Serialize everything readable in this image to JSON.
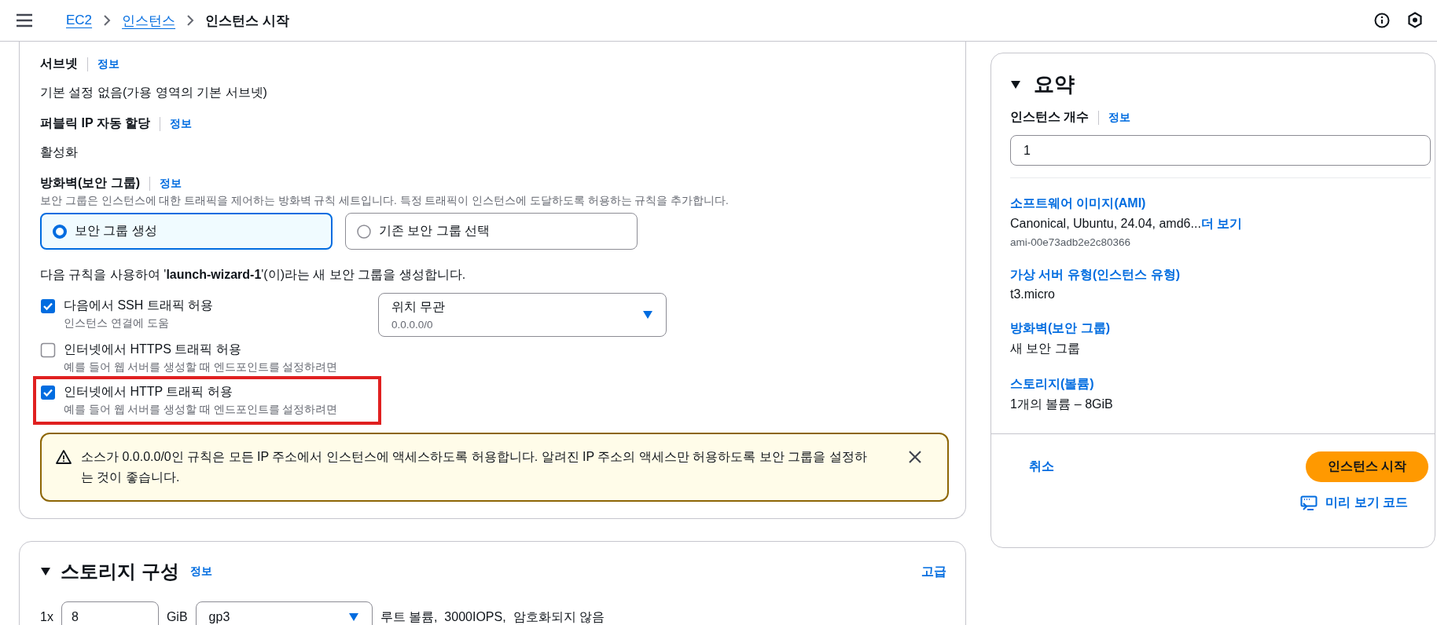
{
  "breadcrumbs": [
    {
      "label": "EC2",
      "link": true
    },
    {
      "label": "인스턴스",
      "link": true
    },
    {
      "label": "인스턴스 시작",
      "link": false
    }
  ],
  "network": {
    "subnet": {
      "label": "서브넷",
      "info": "정보",
      "value": "기본 설정 없음(가용 영역의 기본 서브넷)"
    },
    "public_ip": {
      "label": "퍼블릭 IP 자동 할당",
      "info": "정보",
      "value": "활성화"
    },
    "firewall": {
      "label": "방화벽(보안 그룹)",
      "info": "정보",
      "description": "보안 그룹은 인스턴스에 대한 트래픽을 제어하는 방화벽 규칙 세트입니다. 특정 트래픽이 인스턴스에 도달하도록 허용하는 규칙을 추가합니다.",
      "options": [
        {
          "label": "보안 그룹 생성",
          "selected": true
        },
        {
          "label": "기존 보안 그룹 선택",
          "selected": false
        }
      ],
      "rule_sentence": "다음 규칙을 사용하여 '**launch-wizard-1**'(이)라는 새 보안 그룹을 생성합니다.",
      "rules": [
        {
          "label": "다음에서 SSH 트래픽 허용",
          "hint": "인스턴스 연결에 도움",
          "checked": true,
          "highlighted": false,
          "source": {
            "value": "위치 무관",
            "sub": "0.0.0.0/0"
          }
        },
        {
          "label": "인터넷에서 HTTPS 트래픽 허용",
          "hint": "예를 들어 웹 서버를 생성할 때 엔드포인트를 설정하려면",
          "checked": false,
          "highlighted": false
        },
        {
          "label": "인터넷에서 HTTP 트래픽 허용",
          "hint": "예를 들어 웹 서버를 생성할 때 엔드포인트를 설정하려면",
          "checked": true,
          "highlighted": true
        }
      ],
      "warning": "소스가 0.0.0.0/0인 규칙은 모든 IP 주소에서 인스턴스에 액세스하도록 허용합니다. 알려진 IP 주소의 액세스만 허용하도록 보안 그룹을 설정하는 것이 좋습니다."
    }
  },
  "storage": {
    "title": "스토리지 구성",
    "info": "정보",
    "advanced": "고급",
    "count": "1x",
    "size": "8",
    "unit": "GiB",
    "volume_type": "gp3",
    "summary": "루트 볼륨,  3000IOPS,  암호화되지 않음"
  },
  "summary": {
    "title": "요약",
    "count_label": "인스턴스 개수",
    "info": "정보",
    "count": "1",
    "items": [
      {
        "label": "소프트웨어 이미지(AMI)",
        "value": "Canonical, Ubuntu, 24.04, amd6...",
        "more": "더 보기",
        "sub": "ami-00e73adb2e2c80366"
      },
      {
        "label": "가상 서버 유형(인스턴스 유형)",
        "value": "t3.micro"
      },
      {
        "label": "방화벽(보안 그룹)",
        "value": "새 보안 그룹"
      },
      {
        "label": "스토리지(볼륨)",
        "value": "1개의 볼륨 – 8GiB"
      }
    ],
    "cancel": "취소",
    "launch": "인스턴스 시작",
    "preview": "미리 보기 코드"
  }
}
